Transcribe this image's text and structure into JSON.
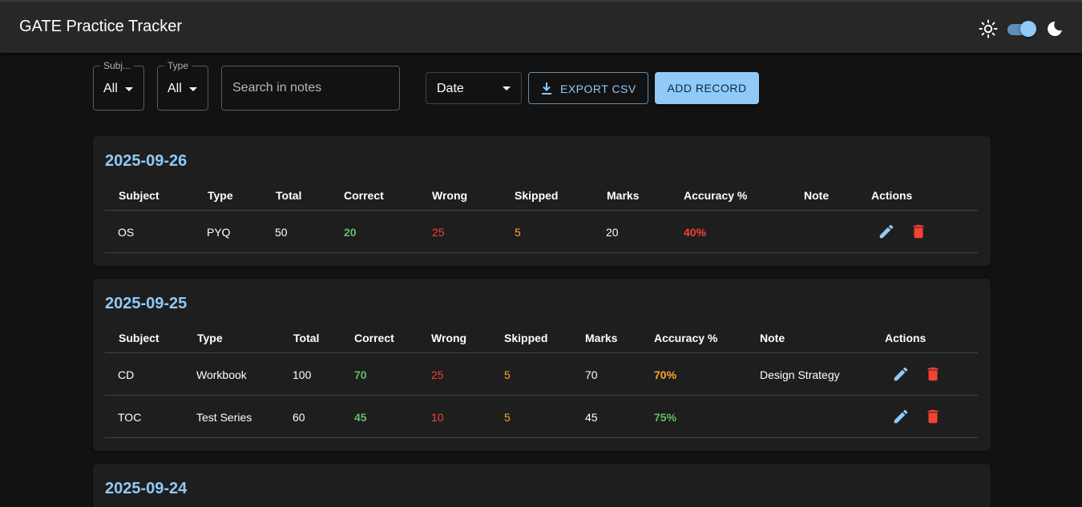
{
  "app": {
    "title": "GATE Practice Tracker"
  },
  "filters": {
    "subject": {
      "legend": "Subj...",
      "value": "All"
    },
    "type": {
      "legend": "Type",
      "value": "All"
    },
    "search": {
      "placeholder": "Search in notes"
    },
    "sort": {
      "value": "Date"
    }
  },
  "actions": {
    "export_label": "EXPORT CSV",
    "add_label": "ADD RECORD"
  },
  "colors": {
    "accent": "#90caf9",
    "correct": "#66bb6a",
    "wrong": "#f44336",
    "skipped": "#ffa726"
  },
  "columns": [
    "Subject",
    "Type",
    "Total",
    "Correct",
    "Wrong",
    "Skipped",
    "Marks",
    "Accuracy %",
    "Note",
    "Actions"
  ],
  "groups": [
    {
      "date": "2025-09-26",
      "rows": [
        {
          "subject": "OS",
          "type": "PYQ",
          "total": "50",
          "correct": "20",
          "wrong": "25",
          "skipped": "5",
          "marks": "20",
          "accuracy": "40%",
          "accuracy_color": "#f44336",
          "note": ""
        }
      ]
    },
    {
      "date": "2025-09-25",
      "rows": [
        {
          "subject": "CD",
          "type": "Workbook",
          "total": "100",
          "correct": "70",
          "wrong": "25",
          "skipped": "5",
          "marks": "70",
          "accuracy": "70%",
          "accuracy_color": "#ffa726",
          "note": "Design Strategy"
        },
        {
          "subject": "TOC",
          "type": "Test Series",
          "total": "60",
          "correct": "45",
          "wrong": "10",
          "skipped": "5",
          "marks": "45",
          "accuracy": "75%",
          "accuracy_color": "#66bb6a",
          "note": ""
        }
      ]
    },
    {
      "date": "2025-09-24",
      "rows": []
    }
  ]
}
